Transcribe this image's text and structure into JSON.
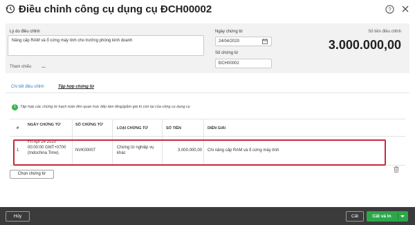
{
  "dialog": {
    "title": "Điều chỉnh công cụ dụng cụ ĐCH00002"
  },
  "form": {
    "reason_label": "Lý do điều chỉnh",
    "reason_value": "Nâng cấp RAM và ổ cứng máy tính cho trưởng phòng kinh doanh",
    "ref_label": "Tham chiếu",
    "ref_value": "...",
    "date_label": "Ngày chứng từ",
    "date_value": "24/04/2020",
    "docno_label": "Số chứng từ",
    "docno_value": "ĐCH00002",
    "amount_label": "Số tiền điều chỉnh",
    "amount_value": "3.000.000,00"
  },
  "tabs": {
    "detail": "Chi tiết điều chỉnh",
    "vouchers": "Tập hợp chứng từ"
  },
  "info": {
    "icon": "i",
    "text": "Tập hợp các chứng từ hạch toán liên quan trực tiếp làm tăng/giảm giá trị còn lại của công cụ dụng cụ"
  },
  "grid": {
    "columns": [
      "#",
      "NGÀY CHỨNG TỪ",
      "SỐ CHỨNG TỪ",
      "LOẠI CHỨNG TỪ",
      "SỐ TIỀN",
      "DIỄN GIẢI"
    ],
    "rows": [
      {
        "index": "1",
        "date": "Fri Apr 24 2020 00:00:00 GMT+0700 (Indochina Time)",
        "docno": "NVK00007",
        "type": "Chứng từ nghiệp vụ khác",
        "amount": "3.000.000,00",
        "desc": "Chi nâng cấp RAM và ổ cứng máy tính"
      }
    ]
  },
  "buttons": {
    "choose": "Chọn chứng từ",
    "cancel": "Hủy",
    "save": "Cất",
    "save_print": "Cất và In"
  },
  "colors": {
    "accent_green": "#2ca84a",
    "highlight_red": "#c8283a",
    "tab_blue": "#3a7bbf",
    "footer_bg": "#3b3b3b"
  }
}
